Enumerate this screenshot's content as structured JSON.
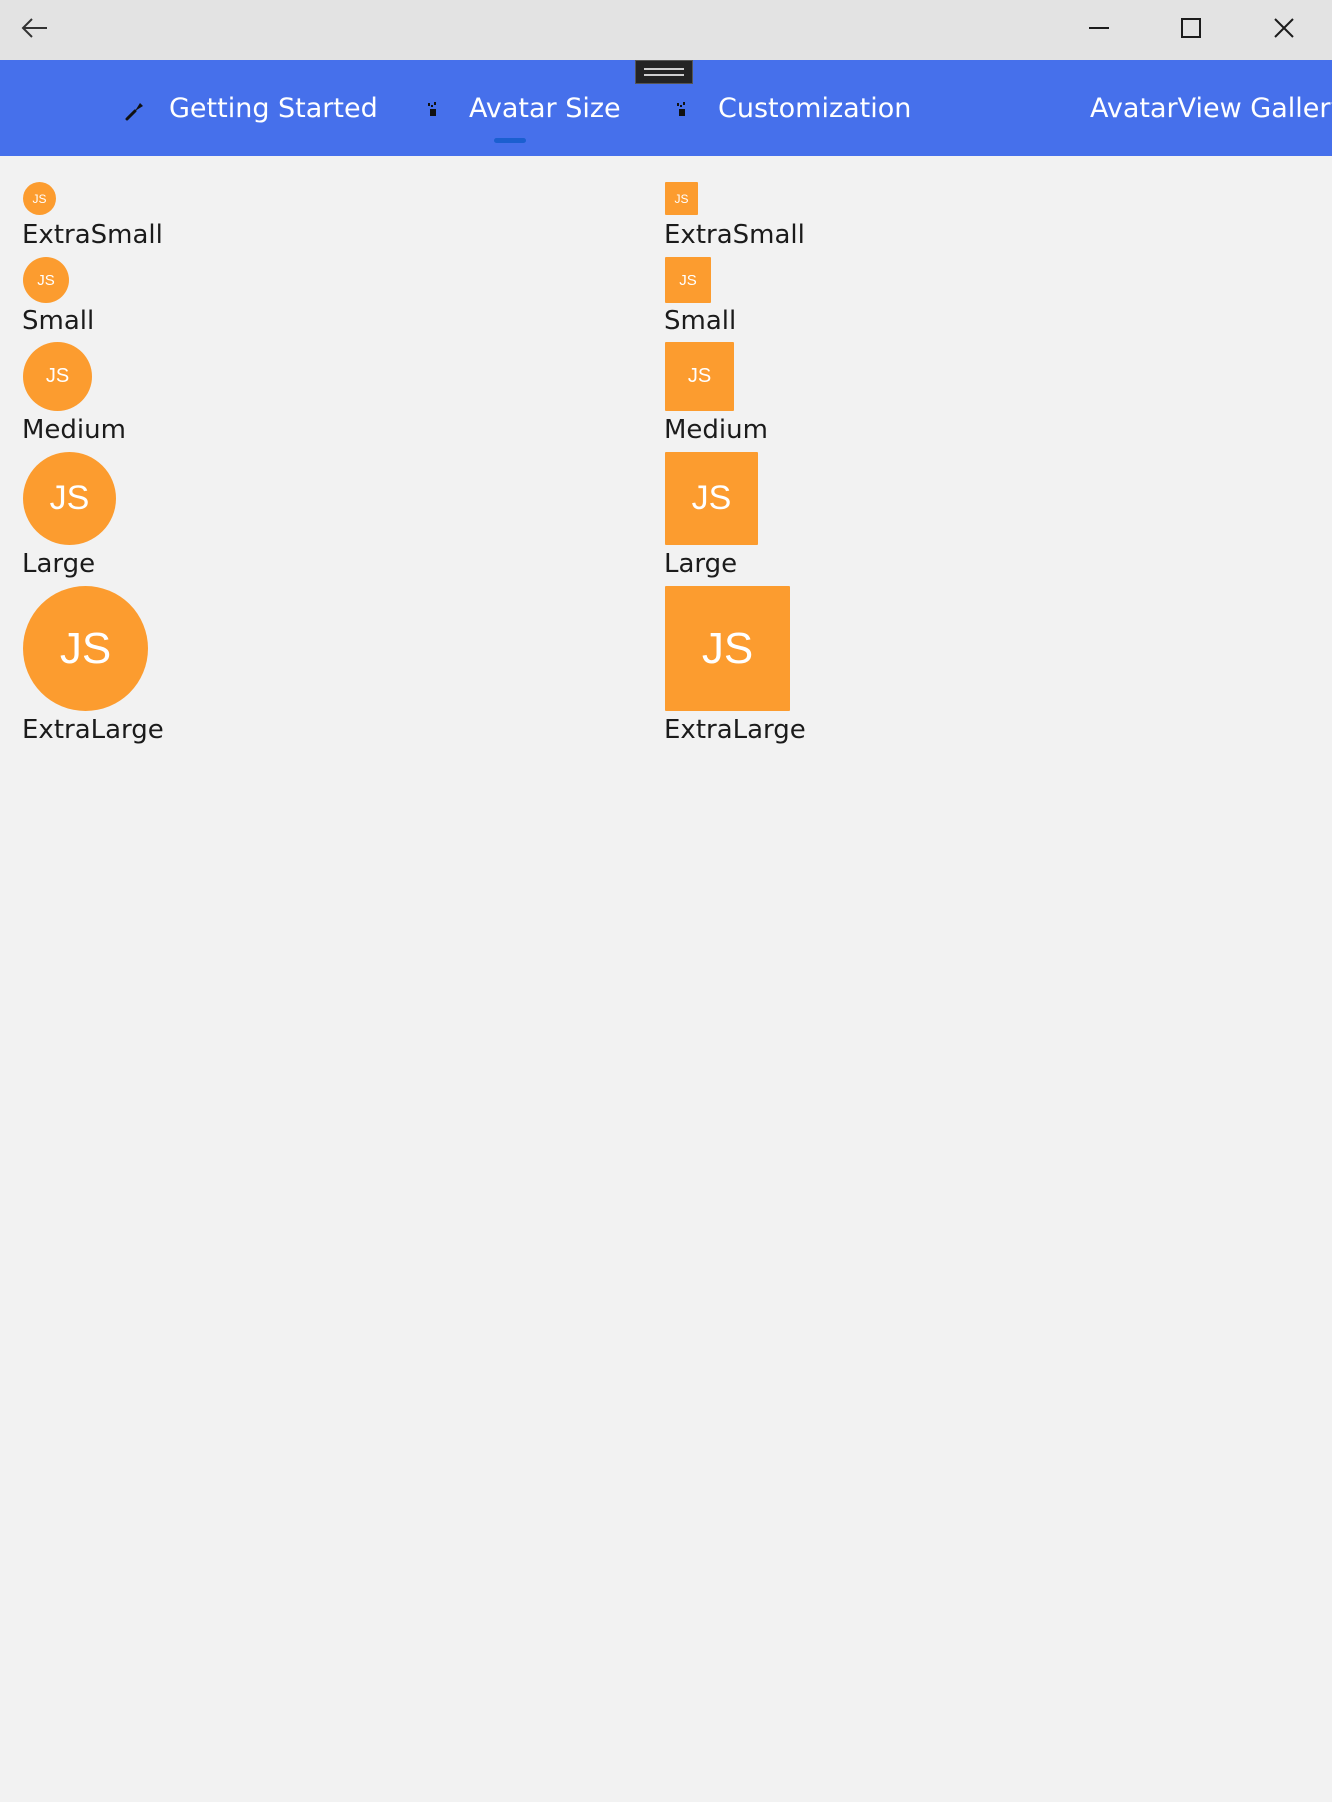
{
  "titlebar": {
    "back_icon": "back-arrow-icon",
    "minimize_icon": "minimize-icon",
    "maximize_icon": "maximize-icon",
    "close_icon": "close-icon"
  },
  "tabs": [
    {
      "label": "Getting Started",
      "icon": "wrench-icon",
      "selected": false
    },
    {
      "label": "Avatar Size",
      "icon": "sparkle-icon",
      "selected": true
    },
    {
      "label": "Customization",
      "icon": "sparkle-icon",
      "selected": false
    },
    {
      "label": "AvatarView Gallery",
      "icon": "",
      "selected": false
    }
  ],
  "colors": {
    "tab_bar": "#4670eb",
    "avatar_fill": "#fc9c2f",
    "selected_indicator": "#1b5fd0",
    "background": "#f2f2f2"
  },
  "avatars": {
    "initials": "JS",
    "round": [
      {
        "label": "ExtraSmall"
      },
      {
        "label": "Small"
      },
      {
        "label": "Medium"
      },
      {
        "label": "Large"
      },
      {
        "label": "ExtraLarge"
      }
    ],
    "square": [
      {
        "label": "ExtraSmall"
      },
      {
        "label": "Small"
      },
      {
        "label": "Medium"
      },
      {
        "label": "Large"
      },
      {
        "label": "ExtraLarge"
      }
    ]
  }
}
